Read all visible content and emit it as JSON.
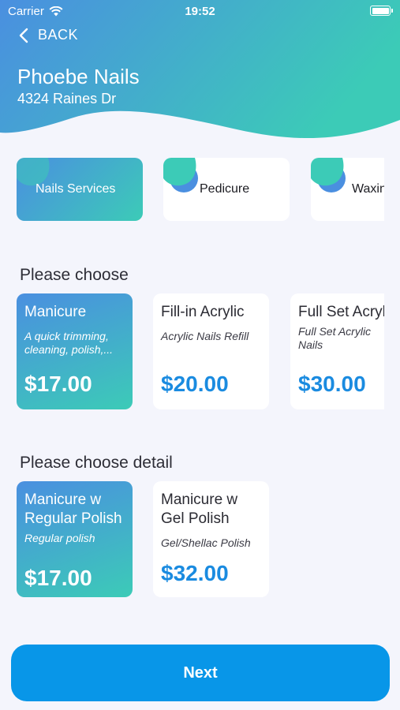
{
  "status_bar": {
    "carrier": "Carrier",
    "time": "19:52",
    "battery": 1.0
  },
  "nav": {
    "back_label": "BACK"
  },
  "salon": {
    "name": "Phoebe Nails",
    "address": "4324 Raines Dr"
  },
  "categories": [
    {
      "label": "Nails Services",
      "selected": true
    },
    {
      "label": "Pedicure",
      "selected": false
    },
    {
      "label": "Waxing",
      "selected": false
    }
  ],
  "services": {
    "title": "Please choose",
    "items": [
      {
        "name": "Manicure",
        "desc": "A quick trimming, cleaning, polish,...",
        "price": "$17.00",
        "selected": true
      },
      {
        "name": "Fill-in Acrylic",
        "desc": "Acrylic Nails Refill",
        "price": "$20.00",
        "selected": false
      },
      {
        "name": "Full Set Acrylic",
        "desc": "Full Set Acrylic Nails",
        "price": "$30.00",
        "selected": false
      }
    ]
  },
  "details": {
    "title": "Please choose detail",
    "items": [
      {
        "name": "Manicure w Regular Polish",
        "desc": "Regular polish",
        "price": "$17.00",
        "selected": true
      },
      {
        "name": "Manicure w Gel Polish",
        "desc": "Gel/Shellac Polish",
        "price": "$32.00",
        "selected": false
      }
    ]
  },
  "footer": {
    "next_label": "Next"
  },
  "colors": {
    "gradient_start": "#4a8fe0",
    "gradient_end": "#3ccbb7",
    "price_blue": "#1a8be0",
    "button": "#0896e8"
  }
}
